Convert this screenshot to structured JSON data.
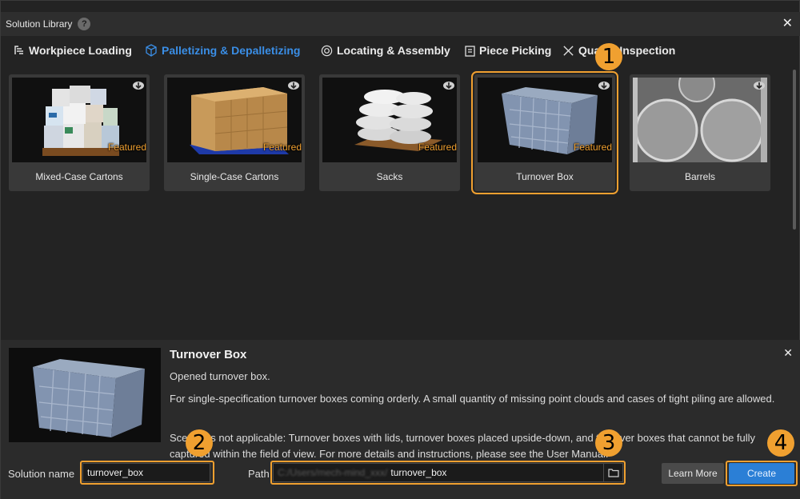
{
  "window": {
    "title": "Solution Library",
    "help": "?",
    "close": "✕"
  },
  "tabs": [
    {
      "label": "Workpiece Loading",
      "icon": "workpiece-icon"
    },
    {
      "label": "Palletizing & Depalletizing",
      "icon": "cube-icon"
    },
    {
      "label": "Locating & Assembly",
      "icon": "target-icon"
    },
    {
      "label": "Piece Picking",
      "icon": "clipboard-icon"
    },
    {
      "label": "Quality Inspection",
      "icon": "tools-icon"
    }
  ],
  "cards": [
    {
      "label": "Mixed-Case Cartons",
      "featured": "Featured"
    },
    {
      "label": "Single-Case Cartons",
      "featured": "Featured"
    },
    {
      "label": "Sacks",
      "featured": "Featured"
    },
    {
      "label": "Turnover Box",
      "featured": "Featured"
    },
    {
      "label": "Barrels",
      "featured": ""
    }
  ],
  "detail": {
    "title": "Turnover Box",
    "line1": "Opened turnover box.",
    "line2": "For single-specification turnover boxes coming orderly. A small quantity of missing point clouds and cases of tight piling are allowed.",
    "line3": "Scenarios not applicable: Turnover boxes with lids, turnover boxes placed upside-down, and turnover boxes that cannot be fully captured within the field of view. For more details and instructions, please see the User Manual.",
    "close": "✕"
  },
  "form": {
    "solution_name_label": "Solution name",
    "solution_name_value": "turnover_box",
    "path_label": "Path",
    "path_prefix": "C:/Users/mech-mind_xxx/",
    "path_value": "turnover_box",
    "learn_more": "Learn More",
    "create": "Create"
  },
  "annotations": [
    "1",
    "2",
    "3",
    "4"
  ],
  "colors": {
    "accent": "#3a8ee6",
    "highlight": "#f0a030",
    "create_button": "#2b7fd6"
  }
}
